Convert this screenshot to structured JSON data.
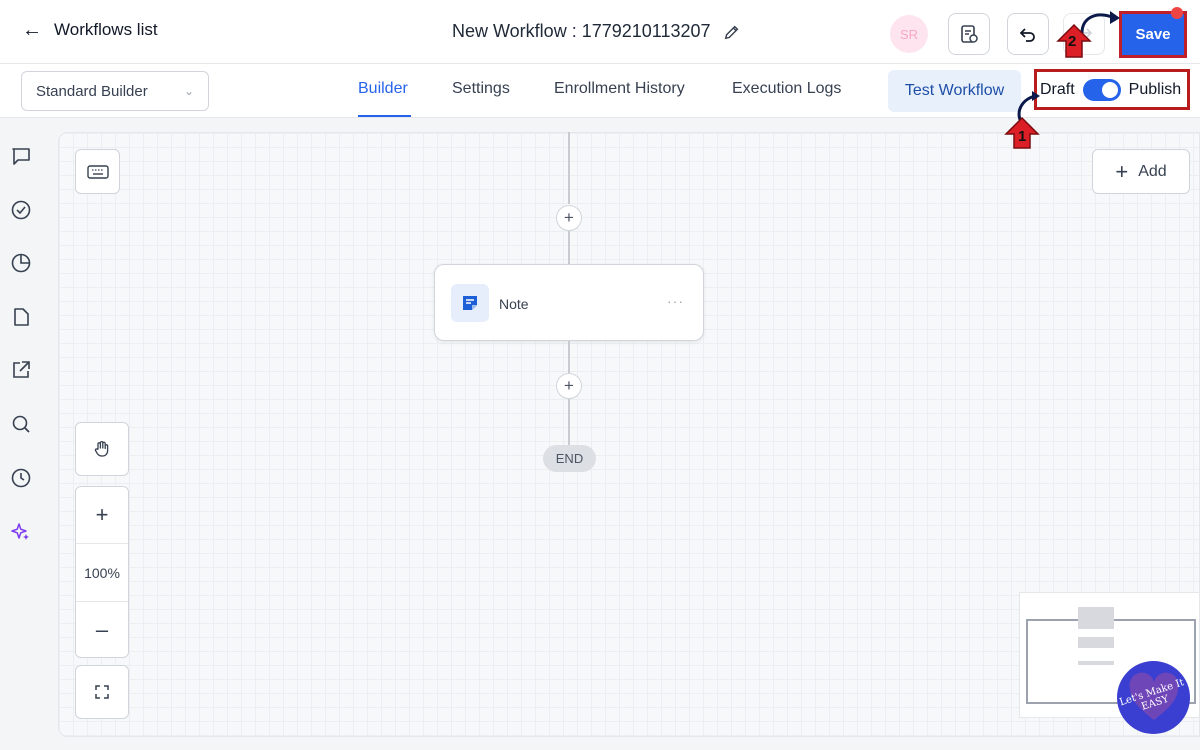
{
  "header": {
    "back_label": "Workflows list",
    "workflow_title": "New Workflow : 1779210113207",
    "avatar_initials": "SR",
    "save_label": "Save"
  },
  "subbar": {
    "builder_select": "Standard Builder",
    "tabs": [
      {
        "label": "Builder",
        "active": true
      },
      {
        "label": "Settings",
        "active": false
      },
      {
        "label": "Enrollment History",
        "active": false
      },
      {
        "label": "Execution Logs",
        "active": false
      }
    ],
    "test_workflow_label": "Test Workflow",
    "draft_label": "Draft",
    "publish_label": "Publish",
    "publish_toggle_on": true
  },
  "canvas": {
    "add_label": "Add",
    "note_label": "Note",
    "end_label": "END",
    "zoom_level": "100%"
  },
  "annotations": {
    "step_1": "1",
    "step_2": "2"
  },
  "watermark": {
    "text": "Let's Make It EASY"
  },
  "colors": {
    "accent": "#2563eb",
    "highlight_box": "#b91c1c",
    "callout_arrow": "#dc1f26"
  },
  "icons": {
    "rail": [
      "chat-icon",
      "check-circle-icon",
      "pie-chart-icon",
      "document-icon",
      "external-link-icon",
      "search-icon",
      "clock-icon",
      "sparkle-icon"
    ]
  }
}
